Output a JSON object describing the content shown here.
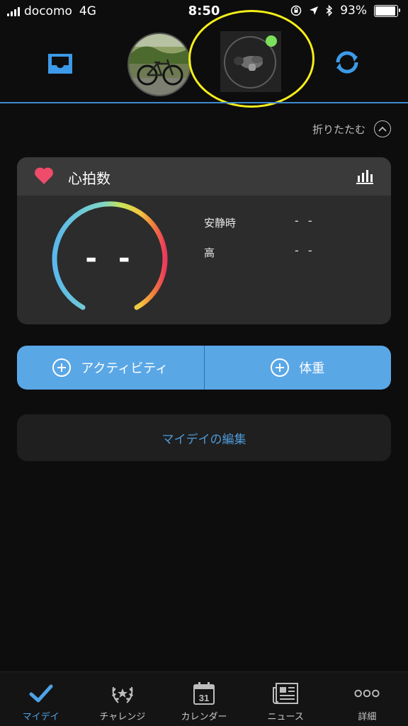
{
  "status_bar": {
    "carrier": "docomo",
    "network": "4G",
    "time": "8:50",
    "battery": "93%",
    "battery_level": 0.93
  },
  "collapse": {
    "label": "折りたたむ"
  },
  "heart_rate_card": {
    "title": "心拍数",
    "gauge_value": "- -",
    "resting_label": "安静時",
    "resting_value": "- -",
    "high_label": "高",
    "high_value": "- -"
  },
  "actions": {
    "activity_label": "アクティビティ",
    "weight_label": "体重"
  },
  "edit_my_day": {
    "label": "マイデイの編集"
  },
  "tabs": [
    {
      "label": "マイデイ",
      "icon": "checkmark-icon",
      "active": true
    },
    {
      "label": "チャレンジ",
      "icon": "laurel-icon",
      "active": false
    },
    {
      "label": "カレンダー",
      "icon": "calendar-icon",
      "calendar_day": "31",
      "active": false
    },
    {
      "label": "ニュース",
      "icon": "newspaper-icon",
      "active": false
    },
    {
      "label": "詳細",
      "icon": "more-icon",
      "active": false
    }
  ],
  "colors": {
    "accent": "#5aa7e6",
    "link": "#4f9bd8",
    "active_tab": "#4fa3e6",
    "heart": "#ef4b6a",
    "device_connected": "#7be05b",
    "highlight": "#f6ee1a"
  }
}
